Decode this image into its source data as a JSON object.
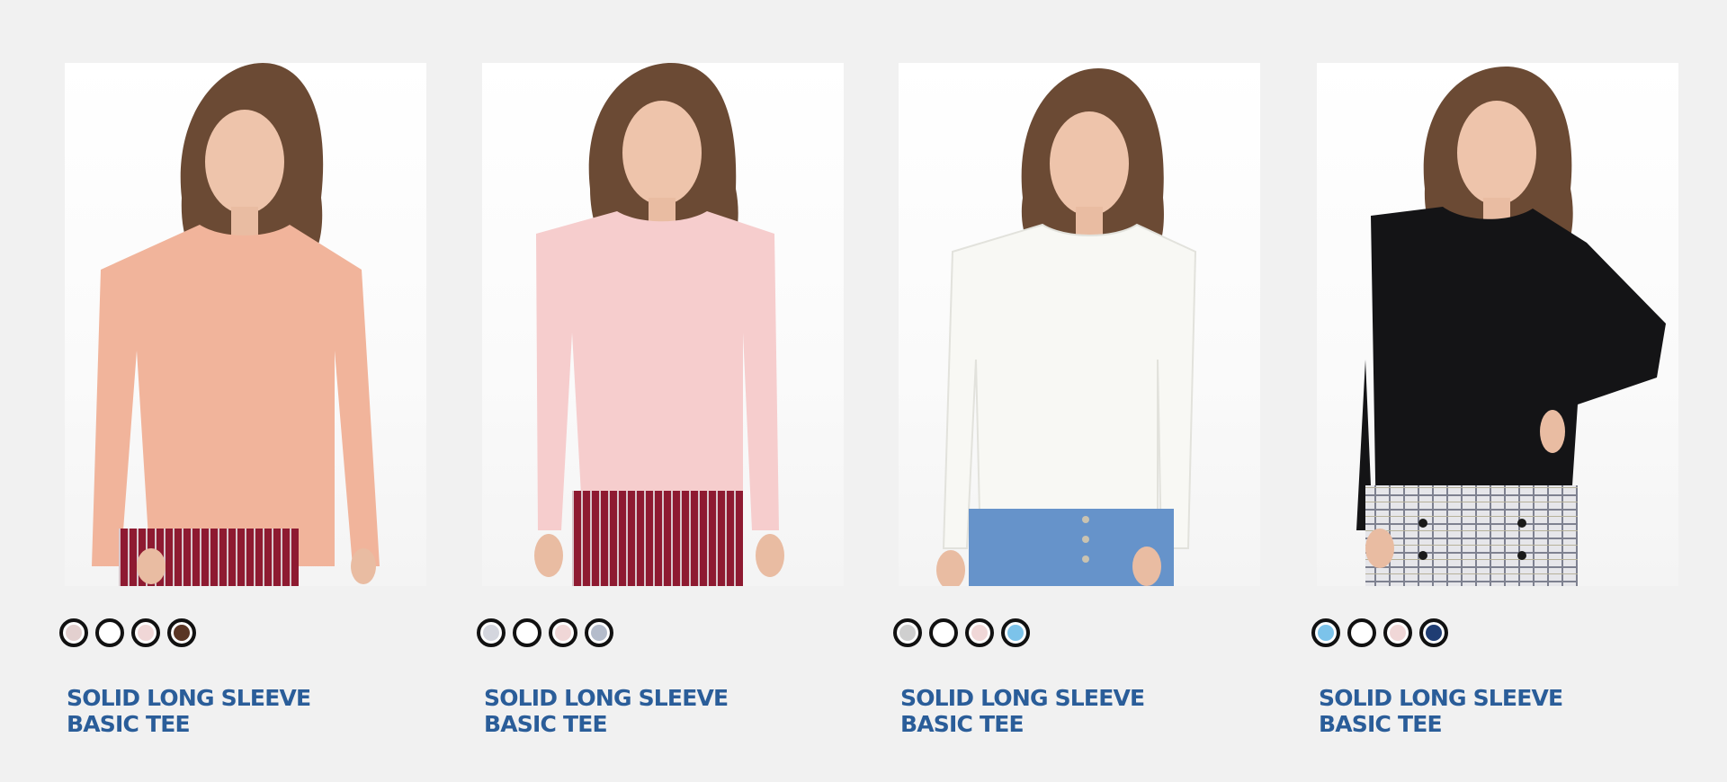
{
  "products": [
    {
      "name_line1": "SOLID LONG SLEEVE",
      "name_line2": "BASIC TEE",
      "shirt_color": "#f1b49b",
      "skirt_color": "#8e1a31",
      "skirt_pattern": "stripes",
      "swatches": [
        "#e3d0cf",
        "#ffffff",
        "#f0d7d7",
        "#5a3524"
      ]
    },
    {
      "name_line1": "SOLID LONG SLEEVE",
      "name_line2": "BASIC TEE",
      "shirt_color": "#f6cdcd",
      "skirt_color": "#8e1a31",
      "skirt_pattern": "stripes",
      "swatches": [
        "#d4d6de",
        "#ffffff",
        "#f0d7d7",
        "#b4bccb"
      ]
    },
    {
      "name_line1": "SOLID LONG SLEEVE",
      "name_line2": "BASIC TEE",
      "shirt_color": "#f8f8f4",
      "skirt_color": "#5d8cc4",
      "skirt_pattern": "denim",
      "swatches": [
        "#cfcfcf",
        "#ffffff",
        "#f0d7d7",
        "#7cc3ea"
      ]
    },
    {
      "name_line1": "SOLID LONG SLEEVE",
      "name_line2": "BASIC TEE",
      "shirt_color": "#141416",
      "skirt_color": "#dcdde0",
      "skirt_pattern": "plaid",
      "swatches": [
        "#7cc3ea",
        "#ffffff",
        "#f0d7d7",
        "#1f3d73"
      ]
    }
  ]
}
